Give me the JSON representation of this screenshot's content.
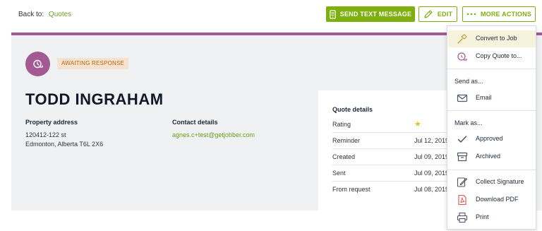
{
  "header": {
    "back_label": "Back to:",
    "back_link": "Quotes",
    "send_text_label": "SEND TEXT MESSAGE",
    "edit_label": "EDIT",
    "more_actions_label": "MORE ACTIONS"
  },
  "quote": {
    "status": "AWAITING RESPONSE",
    "client_name": "TODD INGRAHAM",
    "property_label": "Property address",
    "address_line1": "120412-122 st",
    "address_line2": "Edmonton, Alberta T6L 2X6",
    "contact_label": "Contact details",
    "email": "agnes.c+test@getjobber.com"
  },
  "details": {
    "title": "Quote details",
    "rows": [
      {
        "label": "Rating",
        "value": "★"
      },
      {
        "label": "Reminder",
        "value": "Jul 12, 2019"
      },
      {
        "label": "Created",
        "value": "Jul 09, 2019"
      },
      {
        "label": "Sent",
        "value": "Jul 09, 2019"
      },
      {
        "label": "From request",
        "value": "Jul 08, 2019"
      }
    ]
  },
  "menu": {
    "convert_to_job": "Convert to Job",
    "copy_quote": "Copy Quote to...",
    "send_as": "Send as...",
    "email": "Email",
    "mark_as": "Mark as...",
    "approved": "Approved",
    "archived": "Archived",
    "collect_signature": "Collect Signature",
    "download_pdf": "Download PDF",
    "print": "Print"
  },
  "colors": {
    "accent_green": "#7db00e",
    "purple": "#a25a94",
    "status_bg": "#f7e2cd",
    "status_text": "#b7651d",
    "star": "#e5c21c"
  }
}
